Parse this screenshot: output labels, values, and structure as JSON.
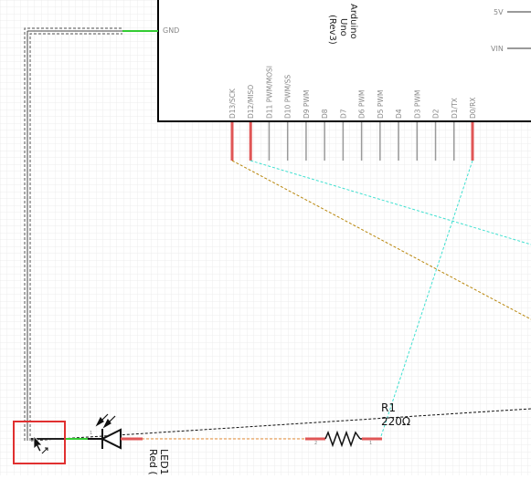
{
  "schematic": {
    "arduino": {
      "title_lines": [
        "Arduino",
        "Uno",
        "(Rev3)"
      ],
      "power_pins": [
        "5V",
        "VIN"
      ],
      "gnd_label": "GND",
      "digital_pins": [
        "D13/SCK",
        "D12/MISO",
        "D11 PWM/MOSI",
        "D10 PWM/SS",
        "D9 PWM",
        "D8",
        "D7",
        "D6 PWM",
        "D5 PWM",
        "D4",
        "D3 PWM",
        "D2",
        "D1/TX",
        "D0/RX"
      ]
    },
    "resistor": {
      "ref": "R1",
      "value": "220Ω",
      "pin1": "1",
      "pin2": "2"
    },
    "led": {
      "ref": "LED1",
      "value": "Red (",
      "pin1": "1",
      "pin2": "2"
    }
  },
  "colors": {
    "grid": "#e9e9e9",
    "connected_pin": "#e05656",
    "unconnected_pin": "#9a9a9a",
    "gnd_wire": "#33cc33",
    "ratsnest_cyan": "#40e0d0",
    "ratsnest_brown": "#b8860b",
    "ratsnest_orange": "#e8903a",
    "selection_box": "#e03030"
  }
}
